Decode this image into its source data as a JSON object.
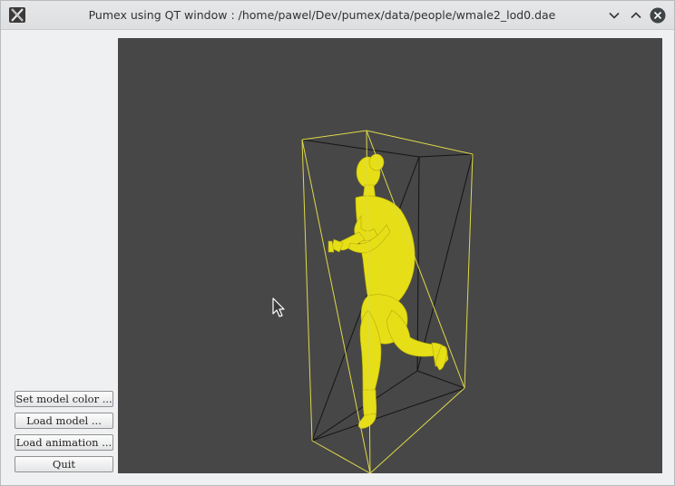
{
  "window": {
    "title": "Pumex using QT window : /home/pawel/Dev/pumex/data/people/wmale2_lod0.dae"
  },
  "buttons": {
    "set_color": "Set model color ...",
    "load_model": "Load model ...",
    "load_animation": "Load animation ...",
    "quit": "Quit"
  },
  "colors": {
    "viewport_bg": "#474747",
    "model": "#e8e01c",
    "bbox_front": "#e6e04a",
    "bbox_back": "#111111"
  },
  "icons": {
    "app": "x11-icon",
    "minimize": "chevron-down-icon",
    "maximize": "chevron-up-icon",
    "close": "close-icon"
  }
}
